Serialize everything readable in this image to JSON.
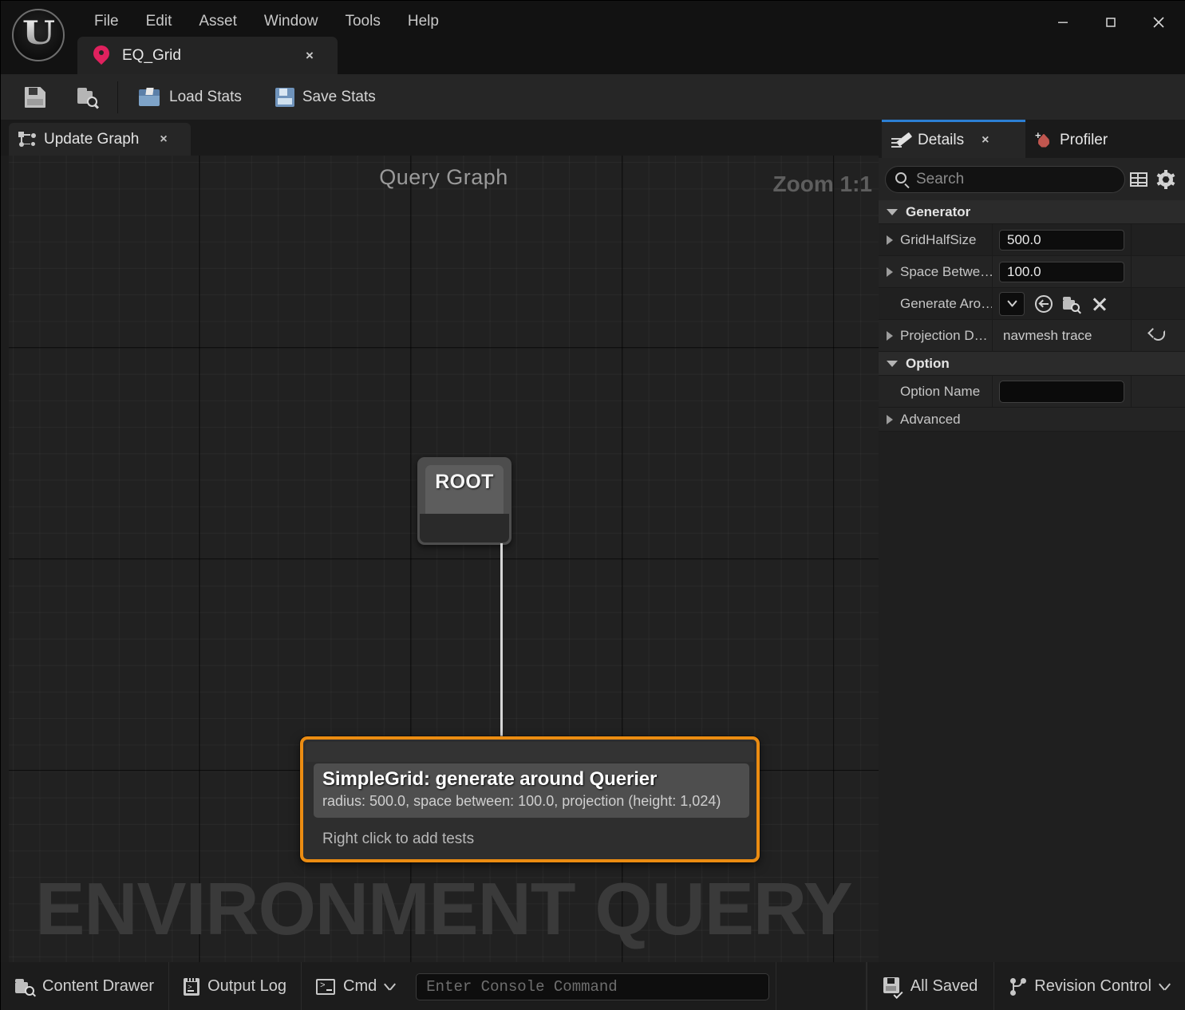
{
  "window": {
    "logo_glyph": "U",
    "menus": [
      "File",
      "Edit",
      "Asset",
      "Window",
      "Tools",
      "Help"
    ],
    "controls": {
      "minimize": "minimize-icon",
      "maximize": "maximize-icon",
      "close": "close-icon"
    },
    "asset_tab": {
      "label": "EQ_Grid",
      "close": "×"
    }
  },
  "toolbar": {
    "save_icon": "save-icon",
    "browse_icon": "browse-content-icon",
    "load_stats": "Load Stats",
    "save_stats": "Save Stats"
  },
  "graph": {
    "tab": {
      "label": "Update Graph",
      "close": "×"
    },
    "title": "Query Graph",
    "zoom": "Zoom 1:1",
    "watermark": "ENVIRONMENT QUERY",
    "root_node": {
      "label": "ROOT"
    },
    "generator_node": {
      "title": "SimpleGrid: generate around Querier",
      "subtitle": "radius: 500.0, space between: 100.0, projection (height: 1,024)",
      "hint": "Right click to add tests",
      "border_color": "#eb8c12"
    }
  },
  "details": {
    "tabs": [
      {
        "label": "Details",
        "icon": "details-pencil-icon",
        "active": true,
        "close": "×"
      },
      {
        "label": "Profiler",
        "icon": "profiler-flame-icon",
        "active": false
      }
    ],
    "search": {
      "value": "",
      "placeholder": "Search"
    },
    "header_icons": [
      "table-view-icon",
      "settings-gear-icon"
    ],
    "sections": [
      {
        "name": "Generator",
        "expanded": true,
        "rows": [
          {
            "name": "GridHalfSize",
            "expandable": true,
            "kind": "number",
            "value": "500.0"
          },
          {
            "name": "Space Betwe…",
            "expandable": true,
            "kind": "number",
            "value": "100.0"
          },
          {
            "name": "Generate Aro…",
            "expandable": false,
            "kind": "object",
            "value": ""
          },
          {
            "name": "Projection D…",
            "expandable": true,
            "kind": "text",
            "value": "navmesh trace",
            "has_reset": true
          }
        ]
      },
      {
        "name": "Option",
        "expanded": true,
        "rows": [
          {
            "name": "Option Name",
            "expandable": false,
            "kind": "textbox",
            "value": ""
          }
        ]
      },
      {
        "name": "Advanced",
        "expanded": false,
        "rows": []
      }
    ]
  },
  "statusbar": {
    "content_drawer": "Content Drawer",
    "output_log": "Output Log",
    "cmd": "Cmd",
    "console": {
      "value": "",
      "placeholder": "Enter Console Command"
    },
    "all_saved": "All Saved",
    "revision_control": "Revision Control"
  }
}
